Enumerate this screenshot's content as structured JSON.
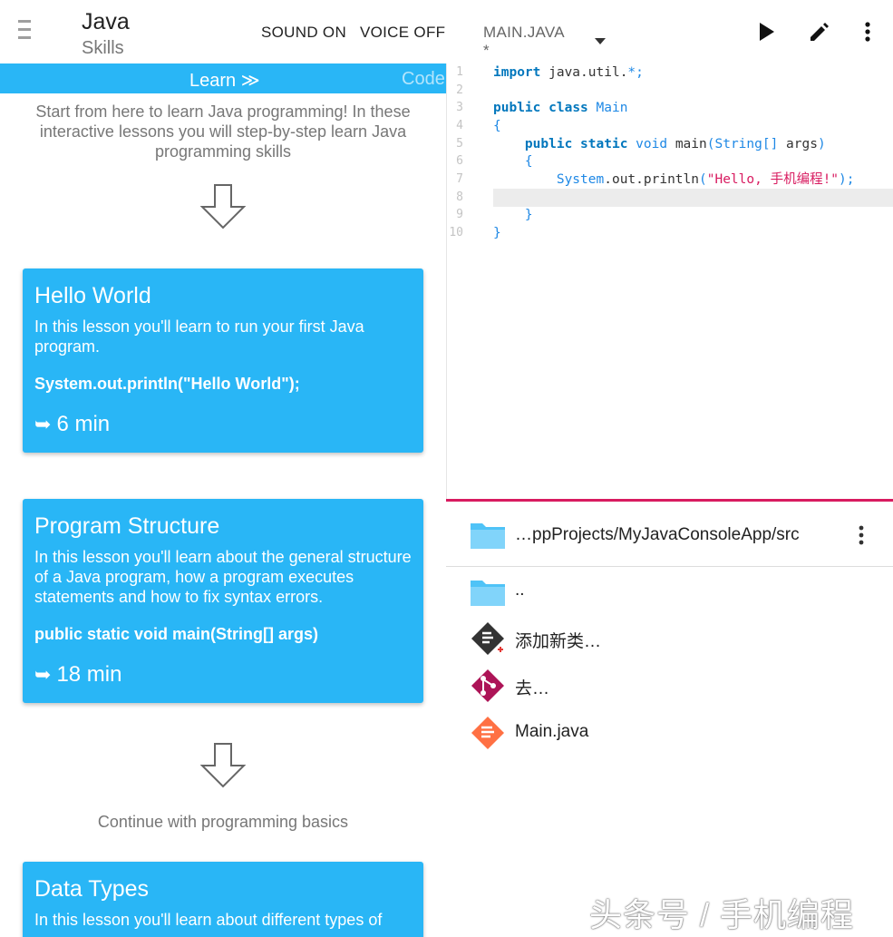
{
  "header": {
    "title": "Java",
    "subtitle": "Skills",
    "sound_label": "SOUND ON",
    "voice_label": "VOICE OFF",
    "file_tab": "MAIN.JAVA *",
    "icons": [
      "menu-icon",
      "play-icon",
      "pencil-icon",
      "more-vert-icon"
    ]
  },
  "tabs": {
    "learn": "Learn ≫",
    "code": "Code"
  },
  "intro": "Start from here to learn Java programming! In these interactive lessons you will step-by-step learn Java programming skills",
  "lessons": [
    {
      "title": "Hello World",
      "desc": "In this lesson you'll learn to run your first Java program.",
      "code": "System.out.println(\"Hello World\");",
      "duration": "6 min"
    },
    {
      "title": "Program Structure",
      "desc": "In this lesson you'll learn about the general structure of a Java program, how a program executes statements and how to fix syntax errors.",
      "code": "public static void main(String[] args)",
      "duration": "18 min"
    },
    {
      "title": "Data Types",
      "desc": "In this lesson you'll learn about different types of",
      "code": "",
      "duration": ""
    }
  ],
  "continue_text": "Continue with programming basics",
  "editor": {
    "line_numbers": [
      "1",
      "2",
      "3",
      "4",
      "5",
      "6",
      "7",
      "8",
      "9",
      "10"
    ],
    "highlighted_line": 8
  },
  "files": {
    "path": "…ppProjects/MyJavaConsoleApp/src",
    "items": [
      {
        "label": "..",
        "icon": "folder-icon"
      },
      {
        "label": "添加新类…",
        "icon": "add-class-icon"
      },
      {
        "label": "去…",
        "icon": "git-icon"
      },
      {
        "label": "Main.java",
        "icon": "java-file-icon"
      }
    ]
  },
  "watermark": "头条号 / 手机编程",
  "colors": {
    "accent": "#29b6f6",
    "divider": "#d81b60",
    "folder": "#4fc3f7"
  }
}
